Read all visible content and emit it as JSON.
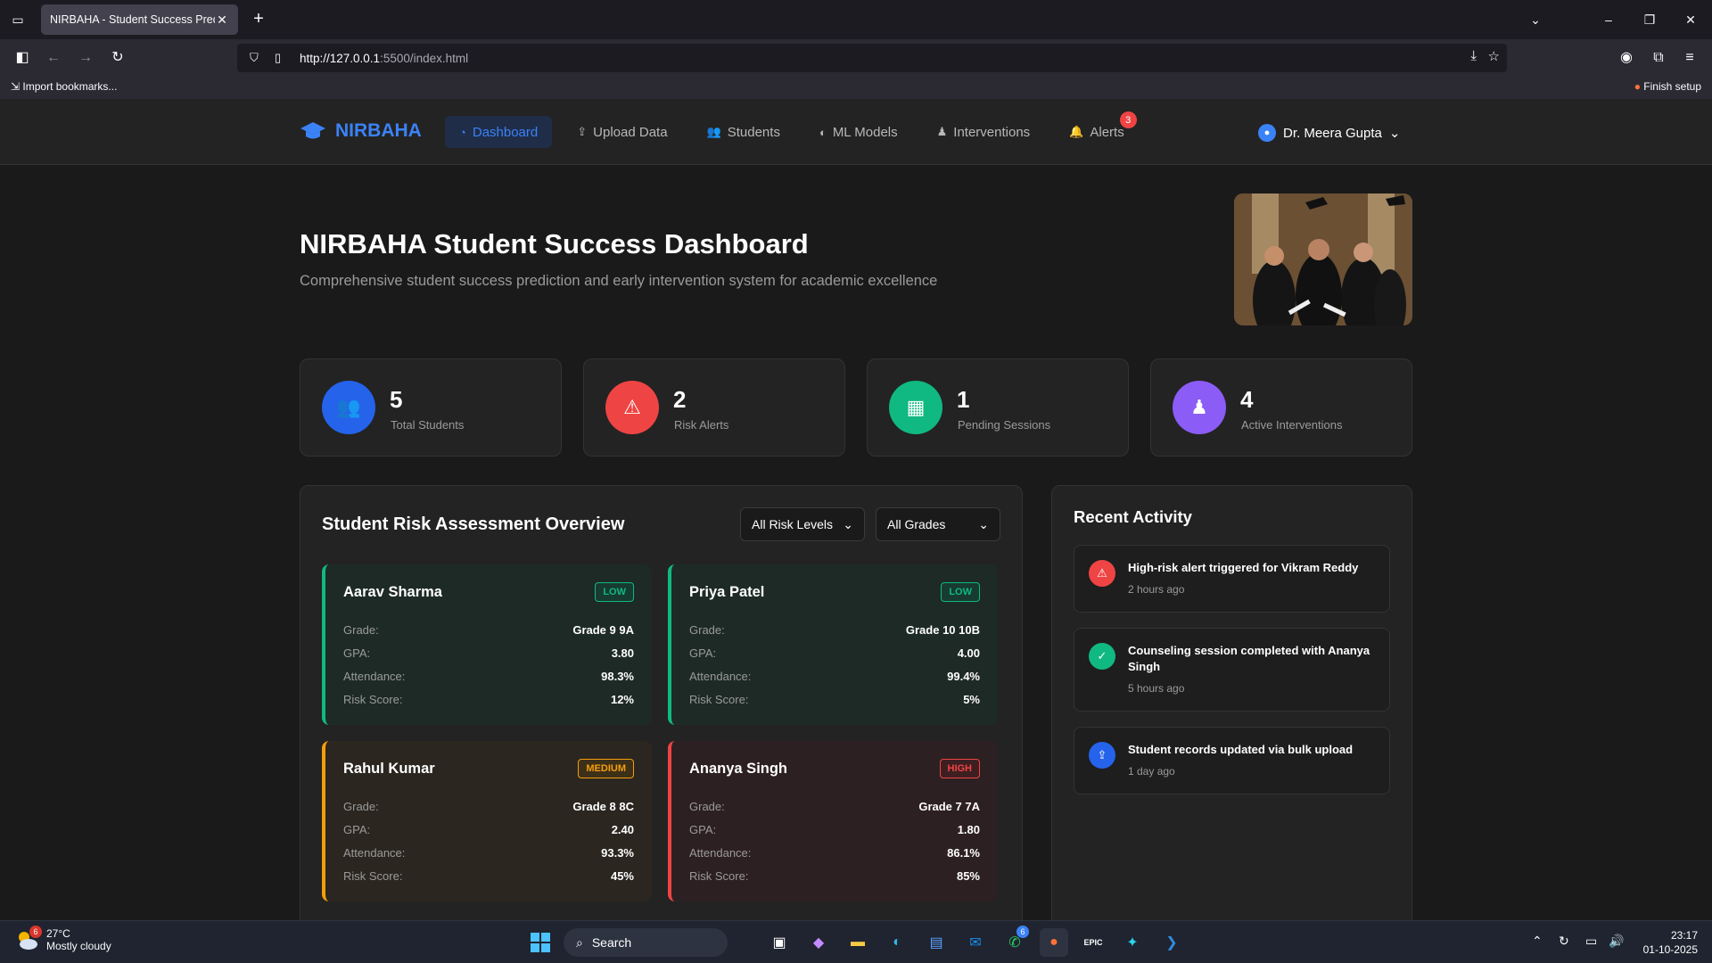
{
  "browser": {
    "tab_title": "NIRBAHA - Student Success Predicti",
    "url_host": "http://127.0.0.1",
    "url_rest": ":5500/index.html",
    "bookmark_import": "Import bookmarks...",
    "finish_setup": "Finish setup"
  },
  "nav": {
    "brand": "NIRBAHA",
    "items": [
      {
        "label": "Dashboard",
        "icon": "dashboard-icon"
      },
      {
        "label": "Upload Data",
        "icon": "upload-icon"
      },
      {
        "label": "Students",
        "icon": "users-icon"
      },
      {
        "label": "ML Models",
        "icon": "brain-icon"
      },
      {
        "label": "Interventions",
        "icon": "user-tie-icon"
      },
      {
        "label": "Alerts",
        "icon": "bell-icon"
      }
    ],
    "alerts_count": "3",
    "user_name": "Dr. Meera Gupta"
  },
  "hero": {
    "title": "NIRBAHA Student Success Dashboard",
    "subtitle": "Comprehensive student success prediction and early intervention system for academic excellence"
  },
  "stats": [
    {
      "value": "5",
      "label": "Total Students",
      "color": "#2563eb",
      "icon": "users-icon"
    },
    {
      "value": "2",
      "label": "Risk Alerts",
      "color": "#ef4444",
      "icon": "warning-icon"
    },
    {
      "value": "1",
      "label": "Pending Sessions",
      "color": "#10b981",
      "icon": "calendar-check-icon"
    },
    {
      "value": "4",
      "label": "Active Interventions",
      "color": "#8b5cf6",
      "icon": "user-tie-icon"
    }
  ],
  "overview": {
    "title": "Student Risk Assessment Overview",
    "filter_risk": "All Risk Levels",
    "filter_grade": "All Grades",
    "labels": {
      "grade": "Grade:",
      "gpa": "GPA:",
      "attendance": "Attendance:",
      "risk": "Risk Score:"
    },
    "students": [
      {
        "name": "Aarav Sharma",
        "level": "LOW",
        "grade": "Grade 9 9A",
        "gpa": "3.80",
        "attendance": "98.3%",
        "risk": "12%"
      },
      {
        "name": "Priya Patel",
        "level": "LOW",
        "grade": "Grade 10 10B",
        "gpa": "4.00",
        "attendance": "99.4%",
        "risk": "5%"
      },
      {
        "name": "Rahul Kumar",
        "level": "MEDIUM",
        "grade": "Grade 8 8C",
        "gpa": "2.40",
        "attendance": "93.3%",
        "risk": "45%"
      },
      {
        "name": "Ananya Singh",
        "level": "HIGH",
        "grade": "Grade 7 7A",
        "gpa": "1.80",
        "attendance": "86.1%",
        "risk": "85%"
      }
    ]
  },
  "activity": {
    "title": "Recent Activity",
    "items": [
      {
        "text": "High-risk alert triggered for Vikram Reddy",
        "time": "2 hours ago",
        "color": "#ef4444",
        "icon": "warning-icon"
      },
      {
        "text": "Counseling session completed with Ananya Singh",
        "time": "5 hours ago",
        "color": "#10b981",
        "icon": "check-circle-icon"
      },
      {
        "text": "Student records updated via bulk upload",
        "time": "1 day ago",
        "color": "#2563eb",
        "icon": "upload-icon"
      }
    ]
  },
  "taskbar": {
    "temp": "27°C",
    "weather": "Mostly cloudy",
    "weather_badge": "6",
    "search": "Search",
    "whatsapp_badge": "6",
    "time": "23:17",
    "date": "01-10-2025"
  }
}
